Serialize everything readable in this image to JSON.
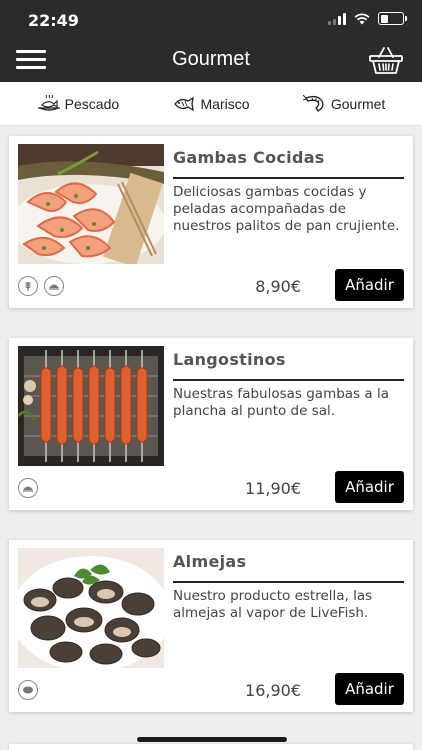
{
  "status_bar": {
    "time": "22:49"
  },
  "header": {
    "title": "Gourmet"
  },
  "tabs": [
    {
      "label": "Pescado"
    },
    {
      "label": "Marisco"
    },
    {
      "label": "Gourmet"
    }
  ],
  "products": [
    {
      "name": "Gambas Cocidas",
      "description": "Deliciosas gambas cocidas y peladas acompañadas de nuestros palitos de pan crujiente.",
      "price": "8,90€",
      "button_label": "Añadir",
      "allergens": [
        "gluten-icon",
        "shellfish-icon"
      ]
    },
    {
      "name": "Langostinos",
      "description": "Nuestras fabulosas gambas a la plancha al punto de sal.",
      "price": "11,90€",
      "button_label": "Añadir",
      "allergens": [
        "shellfish-icon"
      ]
    },
    {
      "name": "Almejas",
      "description": "Nuestro producto estrella, las almejas al vapor de LiveFish.",
      "price": "16,90€",
      "button_label": "Añadir",
      "allergens": [
        "mollusc-icon"
      ]
    }
  ],
  "colors": {
    "header_bg": "#2b2b2b",
    "button_bg": "#000000",
    "page_bg": "#eeeeee"
  }
}
